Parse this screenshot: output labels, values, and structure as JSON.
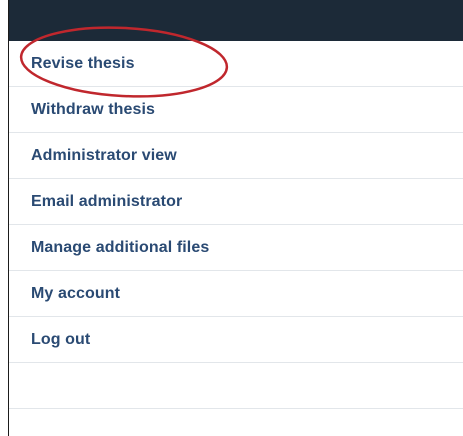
{
  "menu": {
    "items": [
      {
        "label": "Revise thesis",
        "highlighted": true
      },
      {
        "label": "Withdraw thesis"
      },
      {
        "label": "Administrator view"
      },
      {
        "label": "Email administrator"
      },
      {
        "label": "Manage additional files"
      },
      {
        "label": "My account"
      },
      {
        "label": "Log out"
      }
    ]
  },
  "colors": {
    "header_bar": "#1c2a38",
    "link_text": "#2a4a73",
    "divider": "#e2e6ea",
    "annotation_circle": "#c0272d"
  }
}
